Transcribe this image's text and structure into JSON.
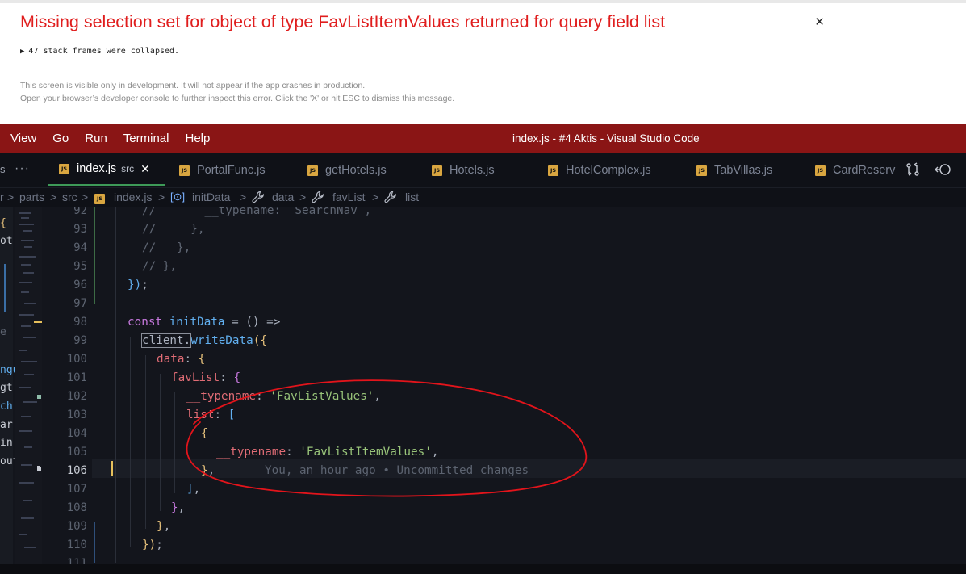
{
  "overlay": {
    "title": "Missing selection set for object of type FavListItemValues returned for query field list",
    "close": "×",
    "frames_toggle": "▶",
    "frames_text": "47 stack frames were collapsed.",
    "note1": "This screen is visible only in development. It will not appear if the app crashes in production.",
    "note2": "Open your browser’s developer console to further inspect this error.  Click the 'X' or hit ESC to dismiss this message."
  },
  "titlebar": {
    "menu": [
      "View",
      "Go",
      "Run",
      "Terminal",
      "Help"
    ],
    "title": "index.js - #4 Aktis - Visual Studio Code",
    "color": "#8a1515"
  },
  "tabs": {
    "overflow": "···",
    "left_fragment": "s",
    "badge": "JS",
    "items": [
      {
        "label": "index.js",
        "desc": "src",
        "close": "✕"
      },
      {
        "label": "PortalFunc.js"
      },
      {
        "label": "getHotels.js"
      },
      {
        "label": "Hotels.js"
      },
      {
        "label": "HotelComplex.js"
      },
      {
        "label": "TabVillas.js"
      },
      {
        "label": "CardReserv"
      }
    ],
    "icons": [
      "compare-changes-icon",
      "go-back-icon"
    ]
  },
  "breadcrumb": {
    "parts": [
      "r",
      "parts",
      "src",
      "index.js",
      "initData",
      "data",
      "favList",
      "list"
    ]
  },
  "sidebar_fragments": [
    "{",
    "ot",
    "e",
    "ngu",
    "gtl",
    "ch.",
    "ar",
    "inl",
    "out"
  ],
  "editor": {
    "line_numbers": [
      "92",
      "93",
      "94",
      "95",
      "96",
      "97",
      "98",
      "99",
      "100",
      "101",
      "102",
      "103",
      "104",
      "105",
      "106",
      "107",
      "108",
      "109",
      "110",
      "111"
    ],
    "current_line": "106",
    "blame": "You, an hour ago • Uncommitted changes",
    "code": {
      "l92": "//       __typename: `SearchNav`,",
      "l93": "//     },",
      "l94": "//   },",
      "l95": "// },",
      "l96_a": "})",
      "l96_b": ";",
      "l98_kw": "const",
      "l98_name": "initData",
      "l98_rest": " = () =>",
      "l99_obj": "client.",
      "l99_fn": "writeData",
      "l99_br": "({",
      "l100_key": "data",
      "l100_rest": ": ",
      "l100_br": "{",
      "l101_key": "favList",
      "l101_rest": ": ",
      "l101_br": "{",
      "l102_key": "__typename",
      "l102_rest": ": ",
      "l102_str": "'FavListValues'",
      "l102_end": ",",
      "l103_key": "list",
      "l103_rest": ": ",
      "l103_br": "[",
      "l104_br": "{",
      "l105_key": "__typename",
      "l105_rest": ": ",
      "l105_str": "'FavListItemValues'",
      "l105_end": ",",
      "l106_br": "}",
      "l106_end": ",",
      "l107_br": "]",
      "l107_end": ",",
      "l108_br": "}",
      "l108_end": ",",
      "l109_br": "}",
      "l109_end": ",",
      "l110_br": "})",
      "l110_end": ";"
    }
  },
  "annotation": {
    "color": "#e3141b"
  }
}
